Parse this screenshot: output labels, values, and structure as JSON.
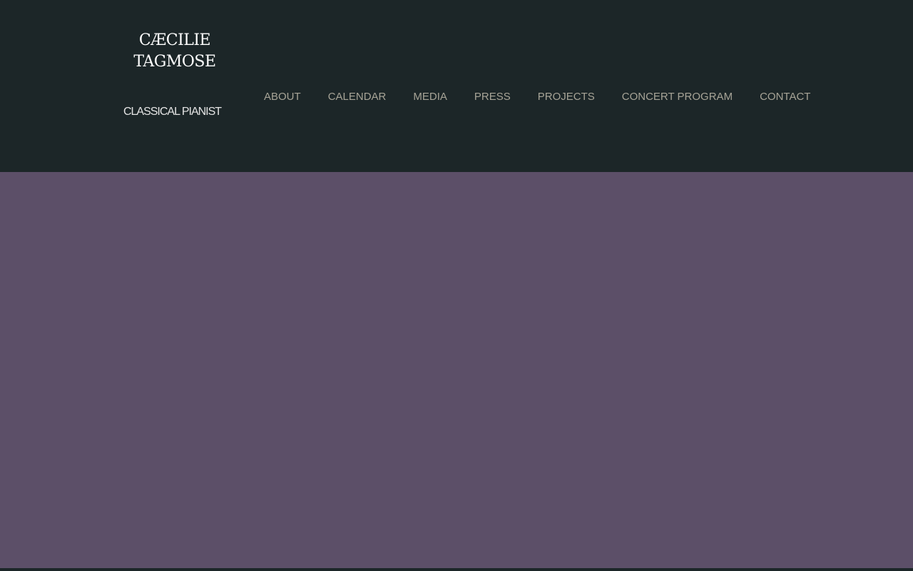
{
  "logo": {
    "line1": "CÆCILIE",
    "line2": "TAGMOSE",
    "subtitle": "CLASSICAL PIANIST"
  },
  "nav": {
    "items": [
      {
        "label": "ABOUT"
      },
      {
        "label": "CALENDAR"
      },
      {
        "label": "MEDIA"
      },
      {
        "label": "PRESS"
      },
      {
        "label": "PROJECTS"
      },
      {
        "label": "CONCERT PROGRAM"
      },
      {
        "label": "CONTACT"
      }
    ]
  },
  "colors": {
    "header_bg": "#1c2628",
    "main_bg": "#5c4f68",
    "nav_text": "#a7a497"
  }
}
